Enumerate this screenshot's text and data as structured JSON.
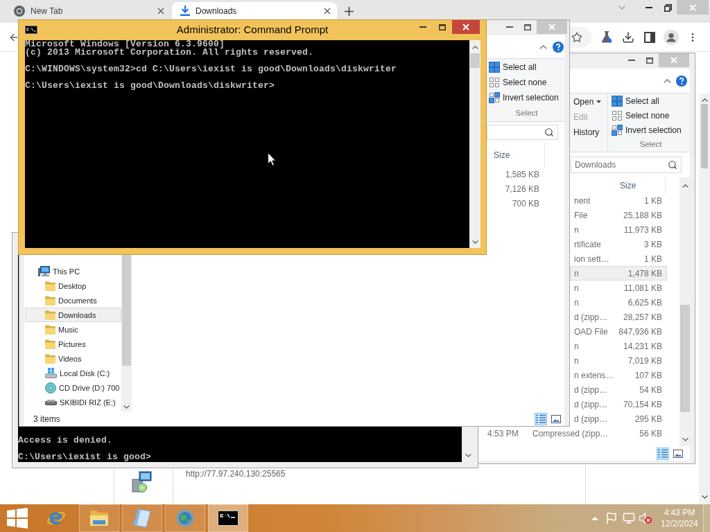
{
  "browser": {
    "tabs": [
      {
        "label": "New Tab",
        "kind": "newtab",
        "selected": false
      },
      {
        "label": "Downloads",
        "kind": "downloads",
        "selected": true
      }
    ],
    "download": {
      "url": "http://77.97.240.130:25565"
    }
  },
  "explorer_back": {
    "ribbon": {
      "open": "Open",
      "edit": {
        "label": "Edit",
        "disabled": true
      },
      "history": "History",
      "select_actions": [
        {
          "label": "Select all",
          "kind": "all"
        },
        {
          "label": "Select none",
          "kind": "none"
        },
        {
          "label": "Invert selection",
          "kind": "invert"
        }
      ],
      "select_group": "Select"
    },
    "search": {
      "placeholder": "Downloads"
    },
    "columns": [
      "Size"
    ],
    "rows": [
      {
        "type": "nent",
        "size": "1 KB",
        "hovered": false
      },
      {
        "type": "File",
        "size": "25,188 KB",
        "hovered": false
      },
      {
        "type": "n",
        "size": "11,973 KB",
        "hovered": false
      },
      {
        "type": "rtificate",
        "size": "3 KB",
        "hovered": false
      },
      {
        "type": "ion sett…",
        "size": "1 KB",
        "hovered": false
      },
      {
        "type": "n",
        "size": "1,478 KB",
        "hovered": true
      },
      {
        "type": "n",
        "size": "11,081 KB",
        "hovered": false
      },
      {
        "type": "n",
        "size": "6,625 KB",
        "hovered": false
      },
      {
        "type": "d (zipp…",
        "size": "28,257 KB",
        "hovered": false
      },
      {
        "type": "OAD File",
        "size": "847,936 KB",
        "hovered": false
      },
      {
        "type": "n",
        "size": "14,231 KB",
        "hovered": false
      },
      {
        "type": "n",
        "size": "7,019 KB",
        "hovered": false
      },
      {
        "type": "n extens…",
        "size": "107 KB",
        "hovered": false
      },
      {
        "type": "d (zipp…",
        "size": "54 KB",
        "hovered": false
      },
      {
        "type": "d (zipp…",
        "size": "70,154 KB",
        "hovered": false
      },
      {
        "type": "d (zipp…",
        "size": "295 KB",
        "hovered": false
      },
      {
        "date": "4:53 PM",
        "type": "Compressed (zipp…",
        "size": "56 KB",
        "hovered": false
      }
    ],
    "views": [
      {
        "kind": "details",
        "selected": true
      },
      {
        "kind": "large_icons",
        "selected": false
      }
    ]
  },
  "console_back": {
    "blocks": [
      {
        "lines": [
          "Access is denied."
        ]
      },
      {
        "lines": [
          "C:\\Users\\iexist is good>"
        ]
      }
    ]
  },
  "explorer_front": {
    "ribbon": {
      "select_actions": [
        {
          "label": "Select all",
          "kind": "all"
        },
        {
          "label": "Select none",
          "kind": "none"
        },
        {
          "label": "Invert selection",
          "kind": "invert"
        }
      ],
      "select_group": "Select"
    },
    "columns": [
      "Size"
    ],
    "rows": [
      {
        "size": "1,585 KB"
      },
      {
        "size": "7,126 KB"
      },
      {
        "size": "700 KB"
      }
    ],
    "nav": [
      {
        "label": "This PC",
        "kind": "pc",
        "selected": false,
        "children": [
          {
            "label": "Desktop",
            "kind": "folder",
            "selected": false
          },
          {
            "label": "Documents",
            "kind": "folder",
            "selected": false
          },
          {
            "label": "Downloads",
            "kind": "folder",
            "selected": true
          },
          {
            "label": "Music",
            "kind": "folder",
            "selected": false
          },
          {
            "label": "Pictures",
            "kind": "folder",
            "selected": false
          },
          {
            "label": "Videos",
            "kind": "folder",
            "selected": false
          },
          {
            "label": "Local Disk (C:)",
            "kind": "disk",
            "selected": false
          },
          {
            "label": "CD Drive (D:) 700",
            "kind": "cd",
            "selected": false
          },
          {
            "label": "SKIBIDI RIZ (E:)",
            "kind": "usb",
            "selected": false
          }
        ]
      }
    ],
    "status": "3 items",
    "views": [
      {
        "kind": "details",
        "selected": true
      },
      {
        "kind": "large_icons",
        "selected": false
      }
    ]
  },
  "console_front": {
    "title": "Administrator: Command Prompt",
    "blocks": [
      {
        "lines": [
          "Microsoft Windows [Version 6.3.9600]",
          "(c) 2013 Microsoft Corporation. All rights reserved."
        ]
      },
      {
        "lines": [
          "C:\\WINDOWS\\system32>cd C:\\Users\\iexist is good\\Downloads\\diskwriter"
        ]
      },
      {
        "lines": [
          "C:\\Users\\iexist is good\\Downloads\\diskwriter>"
        ]
      }
    ]
  },
  "taskbar": {
    "apps": [
      {
        "kind": "web",
        "running": false,
        "active": false
      },
      {
        "kind": "files",
        "running": true,
        "active": false
      },
      {
        "kind": "notes",
        "running": true,
        "active": false
      },
      {
        "kind": "globe",
        "running": true,
        "active": false
      },
      {
        "kind": "console",
        "running": true,
        "active": true
      }
    ],
    "clock": {
      "time": "4:43 PM",
      "date": "12/2/2024"
    }
  }
}
